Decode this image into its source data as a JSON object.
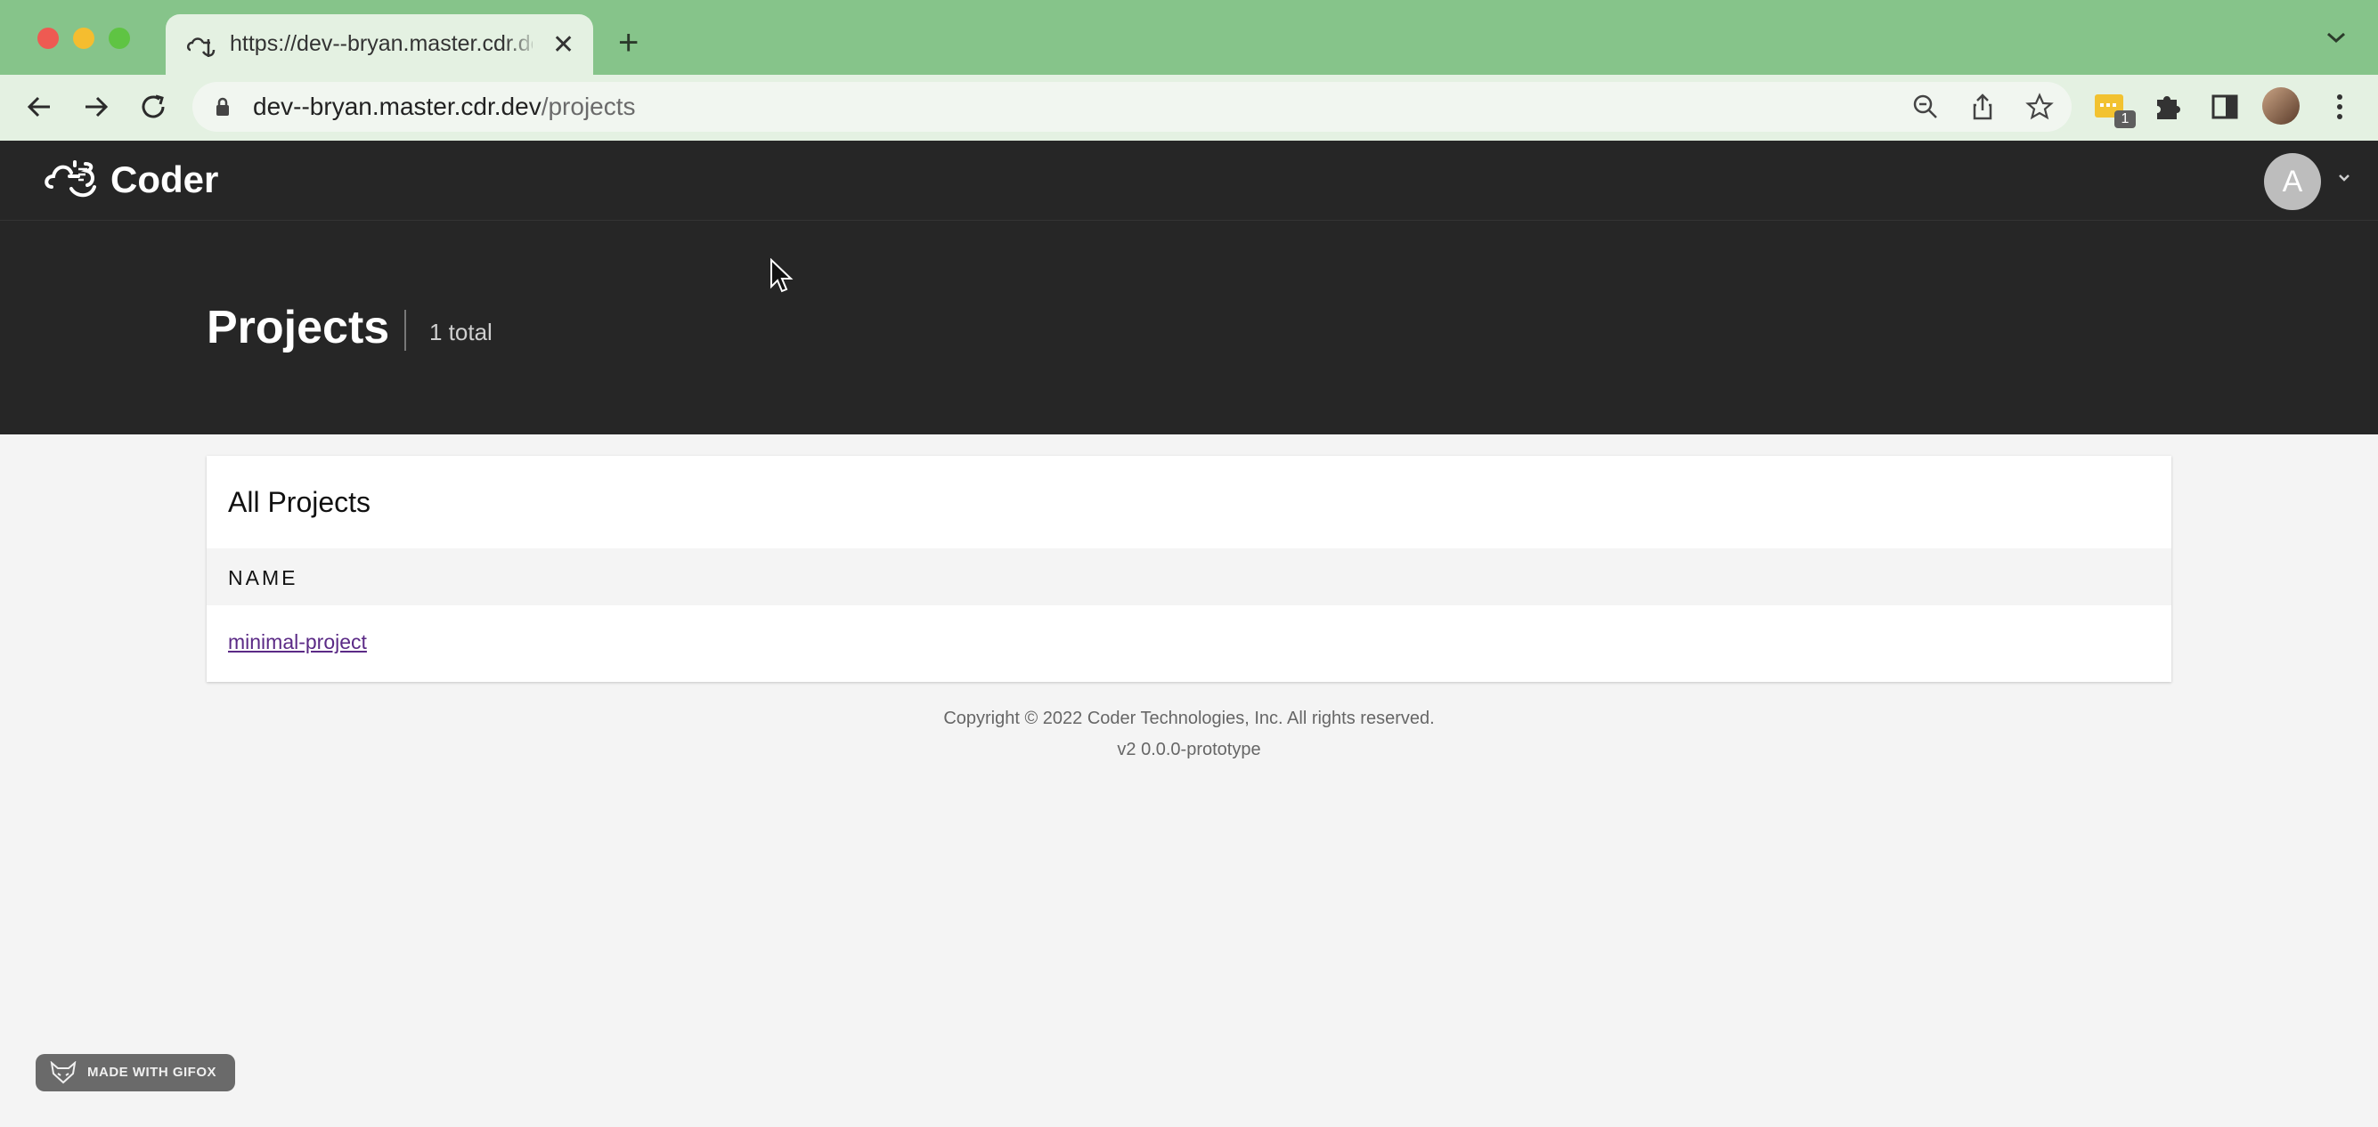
{
  "browser": {
    "tab_title": "https://dev--bryan.master.cdr.dev/projects",
    "url_host": "dev--bryan.master.cdr.dev",
    "url_path": "/projects",
    "extension_badge": "1"
  },
  "app": {
    "brand": "Coder",
    "avatar_initial": "A"
  },
  "page": {
    "title": "Projects",
    "total": "1 total"
  },
  "card": {
    "title": "All Projects",
    "columns": [
      "NAME"
    ],
    "rows": [
      {
        "name": "minimal-project"
      }
    ]
  },
  "footer": {
    "copyright": "Copyright © 2022 Coder Technologies, Inc. All rights reserved.",
    "version": "v2 0.0.0-prototype"
  },
  "watermark": {
    "label": "MADE WITH GIFOX"
  },
  "colors": {
    "tabstrip": "#86c48a",
    "appbar": "#262626",
    "link": "#5b2a86"
  }
}
